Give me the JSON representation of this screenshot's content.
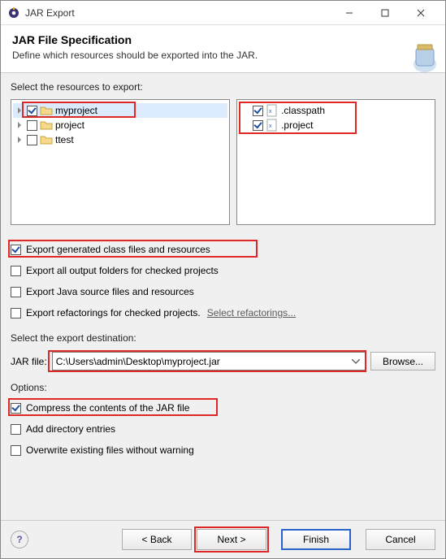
{
  "window": {
    "title": "JAR Export"
  },
  "header": {
    "title": "JAR File Specification",
    "subtitle": "Define which resources should be exported into the JAR."
  },
  "resources": {
    "label": "Select the resources to export:",
    "projects": [
      {
        "name": "myproject",
        "checked": true,
        "expandable": true,
        "highlighted": true,
        "selected": true
      },
      {
        "name": "project",
        "checked": false,
        "expandable": true
      },
      {
        "name": "ttest",
        "checked": false,
        "expandable": true
      }
    ],
    "files": [
      {
        "name": ".classpath",
        "checked": true
      },
      {
        "name": ".project",
        "checked": true
      }
    ]
  },
  "export_opts": {
    "o1": {
      "label": "Export generated class files and resources",
      "checked": true,
      "highlighted": true
    },
    "o2": {
      "label": "Export all output folders for checked projects",
      "checked": false
    },
    "o3": {
      "label": "Export Java source files and resources",
      "checked": false
    },
    "o4": {
      "label": "Export refactorings for checked projects.",
      "checked": false,
      "link": "Select refactorings..."
    }
  },
  "destination": {
    "label": "Select the export destination:",
    "field_label": "JAR file:",
    "value": "C:\\Users\\admin\\Desktop\\myproject.jar",
    "browse": "Browse..."
  },
  "options": {
    "label": "Options:",
    "c1": {
      "label": "Compress the contents of the JAR file",
      "checked": true,
      "highlighted": true
    },
    "c2": {
      "label": "Add directory entries",
      "checked": false
    },
    "c3": {
      "label": "Overwrite existing files without warning",
      "checked": false
    }
  },
  "footer": {
    "back": "< Back",
    "next": "Next >",
    "finish": "Finish",
    "cancel": "Cancel"
  }
}
